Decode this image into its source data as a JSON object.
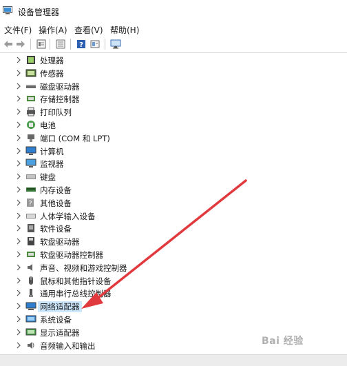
{
  "window": {
    "title": "设备管理器"
  },
  "menu": [
    "文件(F)",
    "操作(A)",
    "查看(V)",
    "帮助(H)"
  ],
  "toolbar": {
    "icons": [
      "back-arrow-icon",
      "forward-arrow-icon",
      "properties-icon",
      "update-icon",
      "help-icon",
      "view-icon",
      "monitor-scan-icon"
    ]
  },
  "tree": {
    "items": [
      {
        "label": "处理器",
        "icon": "cpu-icon"
      },
      {
        "label": "传感器",
        "icon": "sensor-icon"
      },
      {
        "label": "磁盘驱动器",
        "icon": "disk-icon"
      },
      {
        "label": "存储控制器",
        "icon": "storage-icon"
      },
      {
        "label": "打印队列",
        "icon": "printer-icon"
      },
      {
        "label": "电池",
        "icon": "battery-icon"
      },
      {
        "label": "端口 (COM 和 LPT)",
        "icon": "port-icon"
      },
      {
        "label": "计算机",
        "icon": "computer-icon"
      },
      {
        "label": "监视器",
        "icon": "monitor-icon"
      },
      {
        "label": "键盘",
        "icon": "keyboard-icon"
      },
      {
        "label": "内存设备",
        "icon": "memory-icon"
      },
      {
        "label": "其他设备",
        "icon": "unknown-device-icon"
      },
      {
        "label": "人体学输入设备",
        "icon": "hid-icon"
      },
      {
        "label": "软件设备",
        "icon": "software-device-icon"
      },
      {
        "label": "软盘驱动器",
        "icon": "floppy-icon"
      },
      {
        "label": "软盘驱动器控制器",
        "icon": "floppy-controller-icon"
      },
      {
        "label": "声音、视频和游戏控制器",
        "icon": "sound-icon"
      },
      {
        "label": "鼠标和其他指针设备",
        "icon": "mouse-icon"
      },
      {
        "label": "通用串行总线控制器",
        "icon": "usb-icon"
      },
      {
        "label": "网络适配器",
        "icon": "network-adapter-icon"
      },
      {
        "label": "系统设备",
        "icon": "system-device-icon"
      },
      {
        "label": "显示适配器",
        "icon": "display-adapter-icon"
      },
      {
        "label": "音频输入和输出",
        "icon": "audio-io-icon"
      }
    ],
    "selected_index": 19
  },
  "watermark": "Bai 经验",
  "colors": {
    "selection": "#cde8ff",
    "arrow": "#e0393e"
  }
}
